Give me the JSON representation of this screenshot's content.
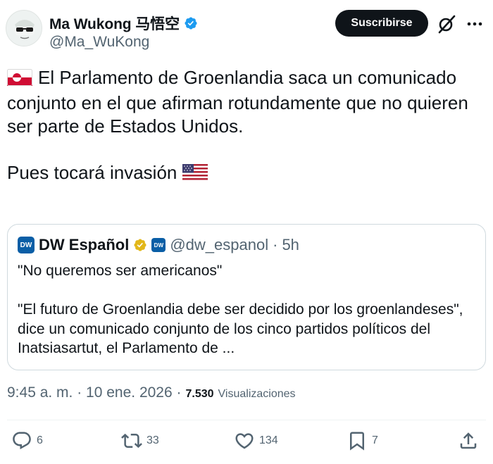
{
  "author": {
    "display_name": "Ma Wukong 马悟空",
    "handle": "@Ma_WuKong"
  },
  "header": {
    "subscribe_label": "Suscribirse"
  },
  "tweet": {
    "paragraph1": "El Parlamento de Groenlandia saca un comunicado conjunto en el que afirman rotundamente que no quieren ser parte de Estados Unidos.",
    "paragraph2": "Pues tocará invasión"
  },
  "quote": {
    "display_name": "DW Español",
    "handle": "@dw_espanol",
    "separator": "·",
    "time": "5h",
    "line1": "\"No queremos ser americanos\"",
    "line2": "\"El futuro de Groenlandia debe ser decidido por los groenlandeses\", dice un comunicado conjunto de los cinco partidos políticos del Inatsiasartut, el Parlamento de ..."
  },
  "meta": {
    "timestamp": "9:45 a. m. · 10 ene. 2026 ·",
    "views_count": "7.530",
    "views_label": "Visualizaciones"
  },
  "actions": {
    "replies": "6",
    "reposts": "33",
    "likes": "134",
    "bookmarks": "7"
  },
  "colors": {
    "text": "#0f1419",
    "secondary": "#536471",
    "verified_blue": "#1d9bf0",
    "verified_gold": "#e2b719",
    "border": "#cfd9de"
  }
}
